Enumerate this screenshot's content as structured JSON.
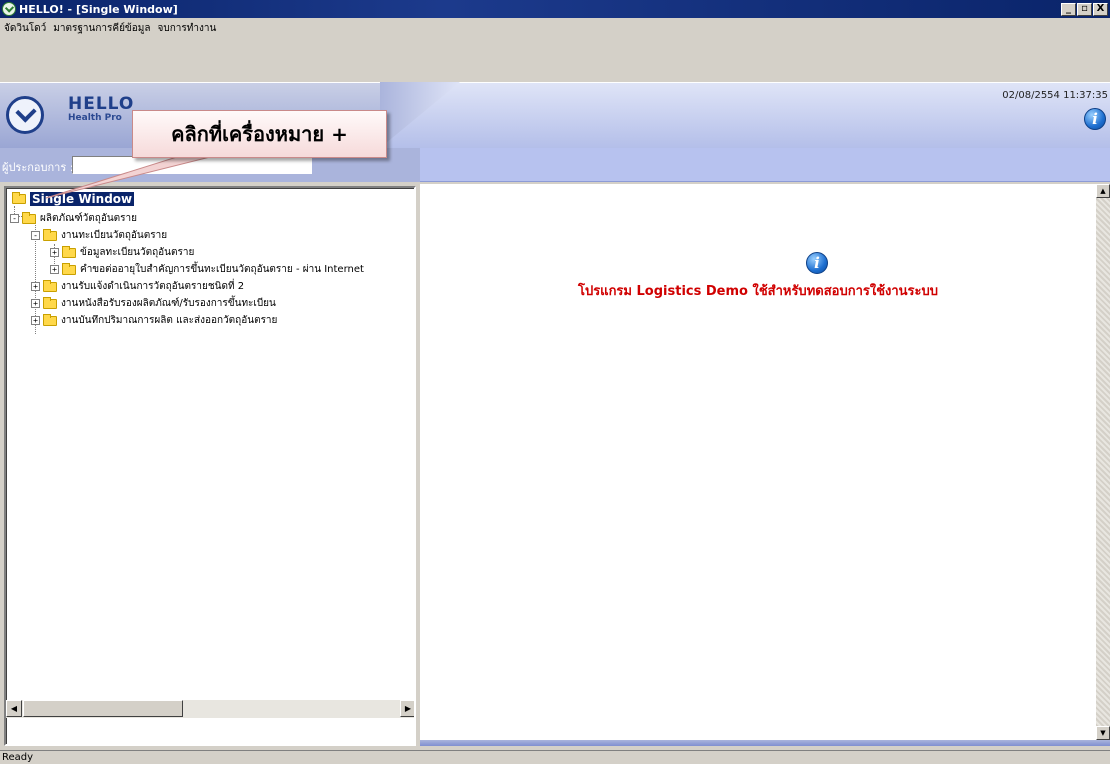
{
  "window": {
    "title": "HELLO! - [Single Window]",
    "min": "_",
    "max": "▫",
    "close": "X"
  },
  "menu": [
    "จัดวินโดว์",
    "มาตรฐานการคีย์ข้อมูล",
    "จบการทำงาน"
  ],
  "header": {
    "logo_text": "HELLO",
    "logo_sub": "Health Pro",
    "datetime": "02/08/2554 11:37:35",
    "info_icon": "info-icon"
  },
  "operator": {
    "label": "ผู้ประกอบการ :",
    "value": ""
  },
  "tree": {
    "root": "Single Window",
    "items": [
      {
        "label": "ผลิตภัณฑ์วัตถุอันตราย",
        "expander": "-"
      },
      {
        "label": "งานทะเบียนวัตถุอันตราย",
        "expander": "-"
      },
      {
        "label": "ข้อมูลทะเบียนวัตถุอันตราย",
        "expander": "+"
      },
      {
        "label": "คำขอต่ออายุใบสำคัญการขึ้นทะเบียนวัตถุอันตราย - ผ่าน Internet",
        "expander": "+"
      },
      {
        "label": "งานรับแจ้งดำเนินการวัตถุอันตรายชนิดที่ 2",
        "expander": "+"
      },
      {
        "label": "งานหนังสือรับรองผลิตภัณฑ์/รับรองการขึ้นทะเบียน",
        "expander": "+"
      },
      {
        "label": "งานบันทึกปริมาณการผลิต และส่งออกวัตถุอันตราย",
        "expander": "+"
      }
    ]
  },
  "content": {
    "message": "โปรแกรม Logistics Demo ใช้สำหรับทดสอบการใช้งานระบบ"
  },
  "status": {
    "text": "Ready"
  },
  "callout": {
    "text": "คลิกที่เครื่องหมาย +"
  },
  "colors": {
    "title_bar": "#0a246a",
    "message": "#d00000",
    "callout_bg": "#f6dada"
  }
}
